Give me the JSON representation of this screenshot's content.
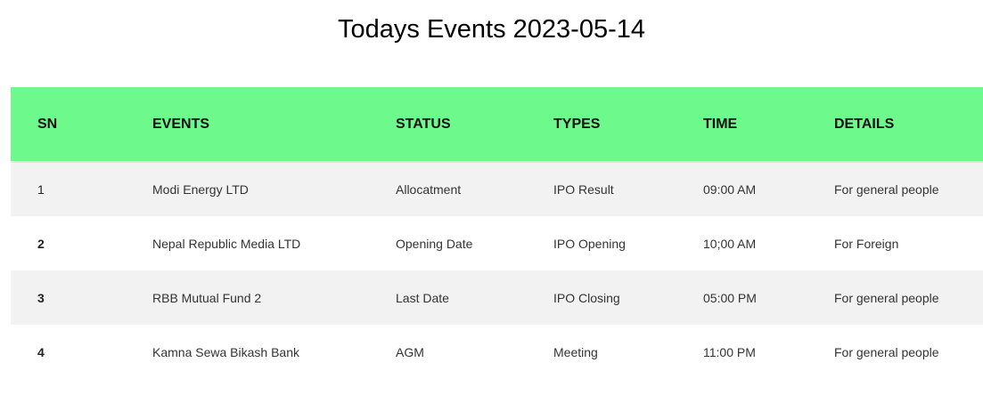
{
  "page": {
    "title": "Todays Events 2023-05-14"
  },
  "table": {
    "header_color": "#6ef98c",
    "columns": [
      "SN",
      "EVENTS",
      "STATUS",
      "TYPES",
      "TIME",
      "DETAILS"
    ],
    "rows": [
      {
        "sn": "1",
        "event": "Modi Energy LTD",
        "status": "Allocatment",
        "type": "IPO Result",
        "time": "09:00 AM",
        "details": "For general people"
      },
      {
        "sn": "2",
        "event": "Nepal Republic Media LTD",
        "status": "Opening Date",
        "type": "IPO Opening",
        "time": "10;00 AM",
        "details": "For Foreign"
      },
      {
        "sn": "3",
        "event": "RBB Mutual Fund 2",
        "status": "Last Date",
        "type": "IPO Closing",
        "time": "05:00 PM",
        "details": "For general people"
      },
      {
        "sn": "4",
        "event": "Kamna Sewa Bikash Bank",
        "status": "AGM",
        "type": "Meeting",
        "time": "11:00 PM",
        "details": "For general people"
      }
    ]
  }
}
